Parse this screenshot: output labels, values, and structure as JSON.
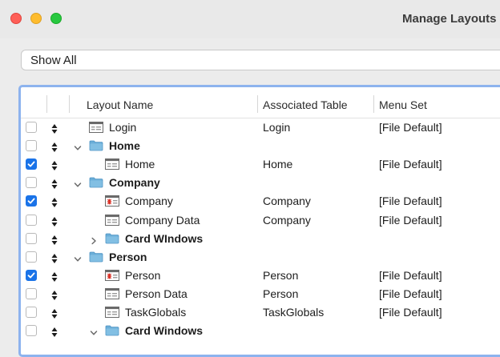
{
  "window": {
    "title": "Manage Layouts"
  },
  "filter": {
    "value": "Show All"
  },
  "columns": {
    "layout_name": "Layout Name",
    "associated_table": "Associated Table",
    "menu_set": "Menu Set"
  },
  "accent_color": "#1a73e8",
  "rows": [
    {
      "kind": "layout",
      "icon": "layout-icon",
      "name": "Login",
      "table": "Login",
      "menu": "[File Default]",
      "checked": false,
      "indent": 0,
      "disclosure": "none"
    },
    {
      "kind": "folder",
      "icon": "folder-icon",
      "name": "Home",
      "table": "",
      "menu": "",
      "checked": false,
      "indent": 0,
      "disclosure": "expanded"
    },
    {
      "kind": "layout",
      "icon": "layout-icon",
      "name": "Home",
      "table": "Home",
      "menu": "[File Default]",
      "checked": true,
      "indent": 1,
      "disclosure": "none"
    },
    {
      "kind": "folder",
      "icon": "folder-icon",
      "name": "Company",
      "table": "",
      "menu": "",
      "checked": false,
      "indent": 0,
      "disclosure": "expanded"
    },
    {
      "kind": "layout",
      "icon": "layout-icon-red",
      "name": "Company",
      "table": "Company",
      "menu": "[File Default]",
      "checked": true,
      "indent": 1,
      "disclosure": "none"
    },
    {
      "kind": "layout",
      "icon": "layout-icon",
      "name": "Company Data",
      "table": "Company",
      "menu": "[File Default]",
      "checked": false,
      "indent": 1,
      "disclosure": "none"
    },
    {
      "kind": "folder",
      "icon": "folder-icon",
      "name": "Card WIndows",
      "table": "",
      "menu": "",
      "checked": false,
      "indent": 1,
      "disclosure": "collapsed"
    },
    {
      "kind": "folder",
      "icon": "folder-icon",
      "name": "Person",
      "table": "",
      "menu": "",
      "checked": false,
      "indent": 0,
      "disclosure": "expanded"
    },
    {
      "kind": "layout",
      "icon": "layout-icon-red",
      "name": "Person",
      "table": "Person",
      "menu": "[File Default]",
      "checked": true,
      "indent": 1,
      "disclosure": "none"
    },
    {
      "kind": "layout",
      "icon": "layout-icon",
      "name": "Person Data",
      "table": "Person",
      "menu": "[File Default]",
      "checked": false,
      "indent": 1,
      "disclosure": "none"
    },
    {
      "kind": "layout",
      "icon": "layout-icon",
      "name": "TaskGlobals",
      "table": "TaskGlobals",
      "menu": "[File Default]",
      "checked": false,
      "indent": 1,
      "disclosure": "none"
    },
    {
      "kind": "folder",
      "icon": "folder-icon",
      "name": "Card Windows",
      "table": "",
      "menu": "",
      "checked": false,
      "indent": 1,
      "disclosure": "expanded"
    }
  ]
}
